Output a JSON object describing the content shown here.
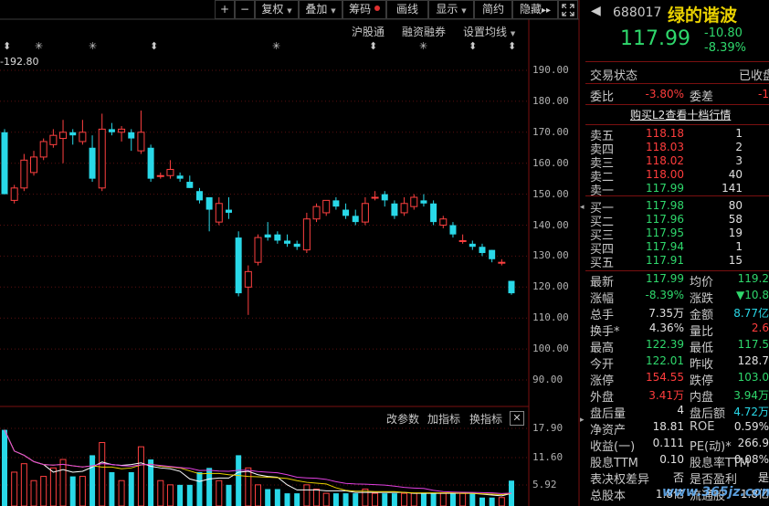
{
  "toolbar": {
    "plus": "+",
    "minus": "−",
    "fuquan": "复权",
    "diejia": "叠加",
    "chouma": "筹码",
    "huaxian": "画线",
    "xianshi": "显示",
    "jianyue": "简约",
    "yincang": "隐藏",
    "dbl_arrow": "▸▸",
    "expand_icon": "expand-icon"
  },
  "subbar": {
    "hugu": "沪股通",
    "rongzi": "融资融券",
    "setting": "设置均线"
  },
  "price_tag": "-192.80",
  "y_axis": [
    "190.00",
    "180.00",
    "170.00",
    "160.00",
    "150.00",
    "140.00",
    "130.00",
    "120.00",
    "110.00",
    "100.00",
    "90.00"
  ],
  "sub_axis": [
    "17.90",
    "11.60",
    "5.92"
  ],
  "sub_toolbar": {
    "gaicanshu": "改参数",
    "jiazhibiao": "加指标",
    "huanzhibiao": "换指标",
    "close": "✕"
  },
  "chart_data": {
    "type": "candlestick",
    "ylim": [
      85,
      197
    ],
    "candles": [
      {
        "o": 170,
        "c": 150,
        "h": 171,
        "l": 150
      },
      {
        "o": 148,
        "c": 152,
        "h": 153,
        "l": 147
      },
      {
        "o": 152,
        "c": 161,
        "h": 163,
        "l": 151
      },
      {
        "o": 157,
        "c": 162,
        "h": 164,
        "l": 156
      },
      {
        "o": 162,
        "c": 167,
        "h": 168,
        "l": 161
      },
      {
        "o": 166,
        "c": 169,
        "h": 171,
        "l": 165
      },
      {
        "o": 168,
        "c": 170,
        "h": 174,
        "l": 160
      },
      {
        "o": 170,
        "c": 169,
        "h": 171,
        "l": 166
      },
      {
        "o": 167,
        "c": 170,
        "h": 174,
        "l": 166
      },
      {
        "o": 165,
        "c": 155,
        "h": 169,
        "l": 154
      },
      {
        "o": 152,
        "c": 171,
        "h": 176,
        "l": 151
      },
      {
        "o": 171,
        "c": 170,
        "h": 173,
        "l": 169
      },
      {
        "o": 170,
        "c": 171,
        "h": 172,
        "l": 167
      },
      {
        "o": 170,
        "c": 168,
        "h": 171,
        "l": 164
      },
      {
        "o": 164,
        "c": 170,
        "h": 177,
        "l": 163
      },
      {
        "o": 165,
        "c": 155,
        "h": 166,
        "l": 154
      },
      {
        "o": 156,
        "c": 156,
        "h": 157,
        "l": 155
      },
      {
        "o": 156,
        "c": 158,
        "h": 161,
        "l": 155
      },
      {
        "o": 156,
        "c": 155,
        "h": 157,
        "l": 154
      },
      {
        "o": 154,
        "c": 152,
        "h": 156,
        "l": 152
      },
      {
        "o": 151,
        "c": 148,
        "h": 152,
        "l": 147
      },
      {
        "o": 149,
        "c": 145,
        "h": 149,
        "l": 138
      },
      {
        "o": 141,
        "c": 147,
        "h": 149,
        "l": 140
      },
      {
        "o": 145,
        "c": 144,
        "h": 149,
        "l": 142
      },
      {
        "o": 136,
        "c": 118,
        "h": 138,
        "l": 117
      },
      {
        "o": 120,
        "c": 125,
        "h": 127,
        "l": 111
      },
      {
        "o": 128,
        "c": 136,
        "h": 137,
        "l": 127
      },
      {
        "o": 137,
        "c": 136,
        "h": 141,
        "l": 135
      },
      {
        "o": 137,
        "c": 135,
        "h": 138,
        "l": 134
      },
      {
        "o": 135,
        "c": 134,
        "h": 137,
        "l": 133
      },
      {
        "o": 134,
        "c": 133,
        "h": 135,
        "l": 132
      },
      {
        "o": 132,
        "c": 142,
        "h": 144,
        "l": 131
      },
      {
        "o": 142,
        "c": 146,
        "h": 147,
        "l": 141
      },
      {
        "o": 144,
        "c": 148,
        "h": 148,
        "l": 143
      },
      {
        "o": 148,
        "c": 146,
        "h": 149,
        "l": 145
      },
      {
        "o": 145,
        "c": 143,
        "h": 147,
        "l": 142
      },
      {
        "o": 143,
        "c": 141,
        "h": 145,
        "l": 140
      },
      {
        "o": 141,
        "c": 147,
        "h": 149,
        "l": 140
      },
      {
        "o": 149,
        "c": 149,
        "h": 151,
        "l": 148
      },
      {
        "o": 150,
        "c": 148,
        "h": 151,
        "l": 146
      },
      {
        "o": 147,
        "c": 143,
        "h": 148,
        "l": 142
      },
      {
        "o": 144,
        "c": 147,
        "h": 149,
        "l": 143
      },
      {
        "o": 146,
        "c": 149,
        "h": 150,
        "l": 145
      },
      {
        "o": 148,
        "c": 147,
        "h": 150,
        "l": 146
      },
      {
        "o": 147,
        "c": 141,
        "h": 148,
        "l": 140
      },
      {
        "o": 140,
        "c": 142,
        "h": 143,
        "l": 139
      },
      {
        "o": 140,
        "c": 137,
        "h": 141,
        "l": 136
      },
      {
        "o": 135,
        "c": 135,
        "h": 137,
        "l": 134
      },
      {
        "o": 134,
        "c": 133,
        "h": 135,
        "l": 132
      },
      {
        "o": 133,
        "c": 131,
        "h": 134,
        "l": 130
      },
      {
        "o": 132,
        "c": 129,
        "h": 132,
        "l": 128
      },
      {
        "o": 128,
        "c": 128,
        "h": 129,
        "l": 127
      },
      {
        "o": 122,
        "c": 118,
        "h": 122,
        "l": 117.5
      }
    ],
    "volume": [
      18,
      8,
      10,
      6,
      7,
      9,
      11,
      7,
      7,
      12,
      15,
      8,
      6,
      8,
      14,
      11,
      6,
      5,
      5,
      5,
      8,
      9,
      6,
      5,
      12,
      9,
      5,
      4,
      4,
      3,
      3,
      5,
      4,
      3,
      3,
      3,
      3,
      4,
      3,
      3,
      3,
      3,
      3,
      3,
      3,
      3,
      3,
      3,
      3,
      2,
      2,
      2,
      6
    ],
    "vol_ylim": [
      0,
      19
    ]
  },
  "stock": {
    "code": "688017",
    "name": "绿的谐波",
    "price": "117.99",
    "change": "-10.80",
    "change_pct": "-8.39%"
  },
  "status": {
    "label": "交易状态",
    "value": "已收盘"
  },
  "wb": {
    "label": "委比",
    "value": "-3.80%",
    "label2": "委差",
    "value2": "-1"
  },
  "l2_link": "购买L2查看十档行情",
  "asks": [
    {
      "label": "卖五",
      "price": "118.18",
      "vol": "1"
    },
    {
      "label": "卖四",
      "price": "118.03",
      "vol": "2"
    },
    {
      "label": "卖三",
      "price": "118.02",
      "vol": "3"
    },
    {
      "label": "卖二",
      "price": "118.00",
      "vol": "40"
    },
    {
      "label": "卖一",
      "price": "117.99",
      "vol": "141"
    }
  ],
  "bids": [
    {
      "label": "买一",
      "price": "117.98",
      "vol": "80"
    },
    {
      "label": "买二",
      "price": "117.96",
      "vol": "58"
    },
    {
      "label": "买三",
      "price": "117.95",
      "vol": "19"
    },
    {
      "label": "买四",
      "price": "117.94",
      "vol": "1"
    },
    {
      "label": "买五",
      "price": "117.91",
      "vol": "15"
    }
  ],
  "stats": [
    {
      "l1": "最新",
      "v1": "117.99",
      "c1": "g",
      "l2": "均价",
      "v2": "119.2",
      "c2": "g"
    },
    {
      "l1": "涨幅",
      "v1": "-8.39%",
      "c1": "g",
      "l2": "涨跌",
      "v2": "▼10.8",
      "c2": "g"
    },
    {
      "l1": "总手",
      "v1": "7.35万",
      "c1": "w",
      "l2": "金额",
      "v2": "8.77亿",
      "c2": "c"
    },
    {
      "l1": "换手*",
      "v1": "4.36%",
      "c1": "w",
      "l2": "量比",
      "v2": "2.6",
      "c2": "r"
    },
    {
      "l1": "最高",
      "v1": "122.39",
      "c1": "g",
      "l2": "最低",
      "v2": "117.5",
      "c2": "g"
    },
    {
      "l1": "今开",
      "v1": "122.01",
      "c1": "g",
      "l2": "昨收",
      "v2": "128.7",
      "c2": "w"
    },
    {
      "l1": "涨停",
      "v1": "154.55",
      "c1": "r",
      "l2": "跌停",
      "v2": "103.0",
      "c2": "g"
    },
    {
      "l1": "外盘",
      "v1": "3.41万",
      "c1": "r",
      "l2": "内盘",
      "v2": "3.94万",
      "c2": "g"
    },
    {
      "l1": "盘后量",
      "v1": "4",
      "c1": "w",
      "l2": "盘后额",
      "v2": "4.72万",
      "c2": "c"
    },
    {
      "l1": "净资产",
      "v1": "18.81",
      "c1": "w",
      "l2": "ROE",
      "v2": "0.59%",
      "c2": "w"
    },
    {
      "l1": "收益(一)",
      "v1": "0.111",
      "c1": "w",
      "l2": "PE(动)*",
      "v2": "266.9",
      "c2": "w"
    },
    {
      "l1": "股息TTM",
      "v1": "0.10",
      "c1": "w",
      "l2": "股息率TTM",
      "v2": "0.08%",
      "c2": "w"
    },
    {
      "l1": "表决权差异",
      "v1": "否",
      "c1": "w",
      "l2": "是否盈利",
      "v2": "是",
      "c2": "w"
    },
    {
      "l1": "总股本",
      "v1": "1.8亿",
      "c1": "w",
      "l2": "流通股",
      "v2": "1.8亿",
      "c2": "w"
    }
  ],
  "watermark": "www.365jz.com"
}
